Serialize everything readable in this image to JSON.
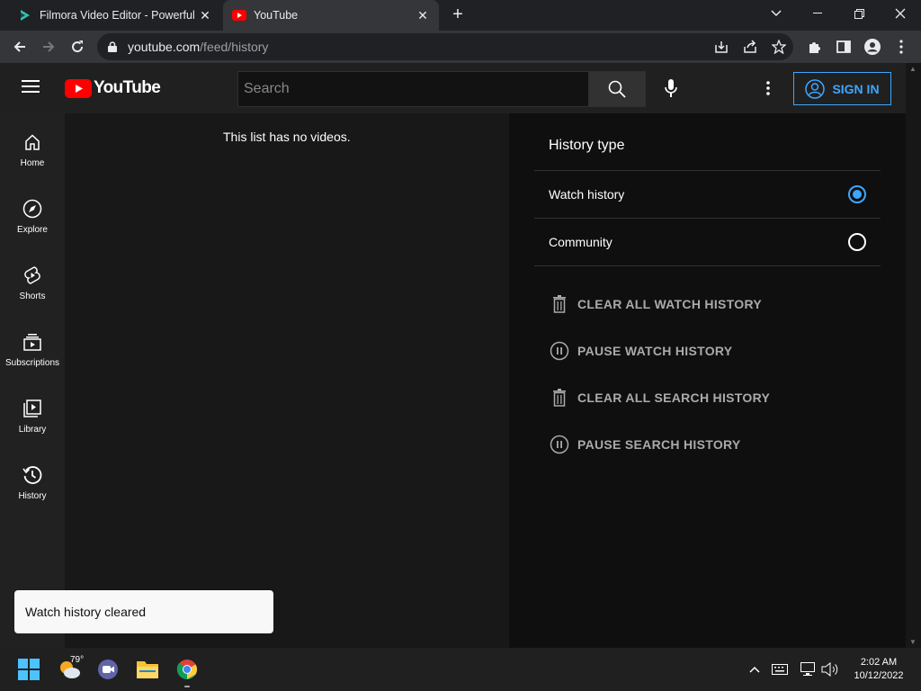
{
  "browser": {
    "tabs": [
      {
        "title": "Filmora Video Editor - Powerful V",
        "active": false
      },
      {
        "title": "YouTube",
        "active": true
      }
    ],
    "new_tab": "+",
    "url": {
      "host": "youtube.com",
      "path": "/feed/history"
    }
  },
  "youtube": {
    "logo_text": "YouTube",
    "search_placeholder": "Search",
    "sign_in": "SIGN IN",
    "nav": [
      {
        "label": "Home",
        "icon": "home-icon"
      },
      {
        "label": "Explore",
        "icon": "compass-icon"
      },
      {
        "label": "Shorts",
        "icon": "shorts-icon"
      },
      {
        "label": "Subscriptions",
        "icon": "subscriptions-icon"
      },
      {
        "label": "Library",
        "icon": "library-icon"
      },
      {
        "label": "History",
        "icon": "history-icon"
      }
    ],
    "empty_message": "This list has no videos.",
    "history_panel": {
      "title": "History type",
      "options": [
        {
          "label": "Watch history",
          "selected": true
        },
        {
          "label": "Community",
          "selected": false
        }
      ],
      "actions": [
        {
          "label": "CLEAR ALL WATCH HISTORY",
          "icon": "trash-icon"
        },
        {
          "label": "PAUSE WATCH HISTORY",
          "icon": "pause-icon"
        },
        {
          "label": "CLEAR ALL SEARCH HISTORY",
          "icon": "trash-icon"
        },
        {
          "label": "PAUSE SEARCH HISTORY",
          "icon": "pause-icon"
        }
      ]
    },
    "toast": "Watch history cleared",
    "accent_color": "#3ea6ff",
    "brand_color": "#ff0000"
  },
  "taskbar": {
    "weather": "79°",
    "time": "2:02 AM",
    "date": "10/12/2022"
  }
}
